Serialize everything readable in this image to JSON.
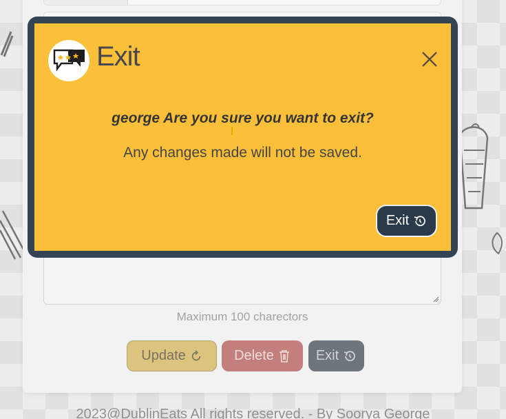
{
  "form": {
    "hint": "Maximum 100 charectors",
    "buttons": {
      "update_label": "Update",
      "delete_label": "Delete",
      "exit_label": "Exit"
    }
  },
  "footer": {
    "text": "2023@DublinEats All rights reserved. - By Soorya George"
  },
  "modal": {
    "title": "Exit",
    "question": "george Are you sure you want to exit?",
    "message": "Any changes made will not be saved.",
    "exit_label": "Exit"
  },
  "icons": {
    "logo": "review-chat-stars-icon",
    "close": "close-icon",
    "refresh": "refresh-icon",
    "trash": "trash-icon",
    "undo": "undo-icon"
  },
  "colors": {
    "modal_bg": "#fbbf3a",
    "modal_border": "#344455",
    "update": "#c9a43a",
    "delete": "#a33b35",
    "exit": "#2b3a4b"
  }
}
